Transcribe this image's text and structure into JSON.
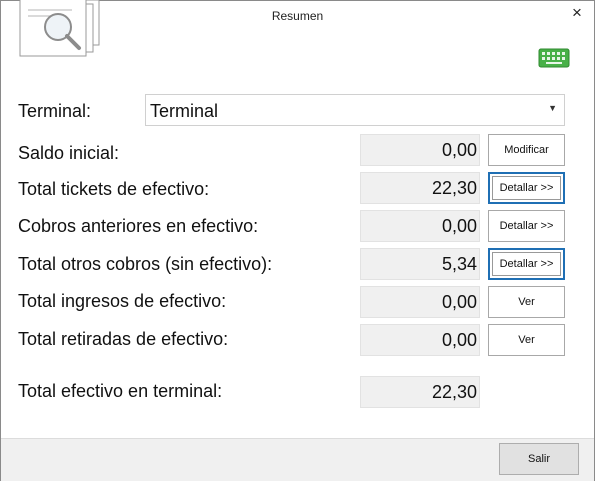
{
  "window": {
    "title": "Resumen",
    "close_label": "×"
  },
  "icons": {
    "logo": "report-search-icon",
    "keyboard": "keyboard-icon",
    "keyboard_color": "#3aa63a"
  },
  "colors": {
    "focus_border": "#1f6fb4",
    "value_bg": "#f0f0f0"
  },
  "terminal": {
    "label": "Terminal:",
    "selected": "Terminal"
  },
  "rows": [
    {
      "label": "Saldo inicial:",
      "value": "0,00",
      "button": "Modificar"
    },
    {
      "label": "Total tickets de efectivo:",
      "value": "22,30",
      "button": "Detallar >>"
    },
    {
      "label": "Cobros anteriores en efectivo:",
      "value": "0,00",
      "button": "Detallar >>"
    },
    {
      "label": "Total otros cobros (sin efectivo):",
      "value": "5,34",
      "button": "Detallar >>"
    },
    {
      "label": "Total ingresos de efectivo:",
      "value": "0,00",
      "button": "Ver"
    },
    {
      "label": "Total retiradas de efectivo:",
      "value": "0,00",
      "button": "Ver"
    }
  ],
  "total": {
    "label": "Total efectivo en terminal:",
    "value": "22,30"
  },
  "footer": {
    "exit_label": "Salir"
  }
}
